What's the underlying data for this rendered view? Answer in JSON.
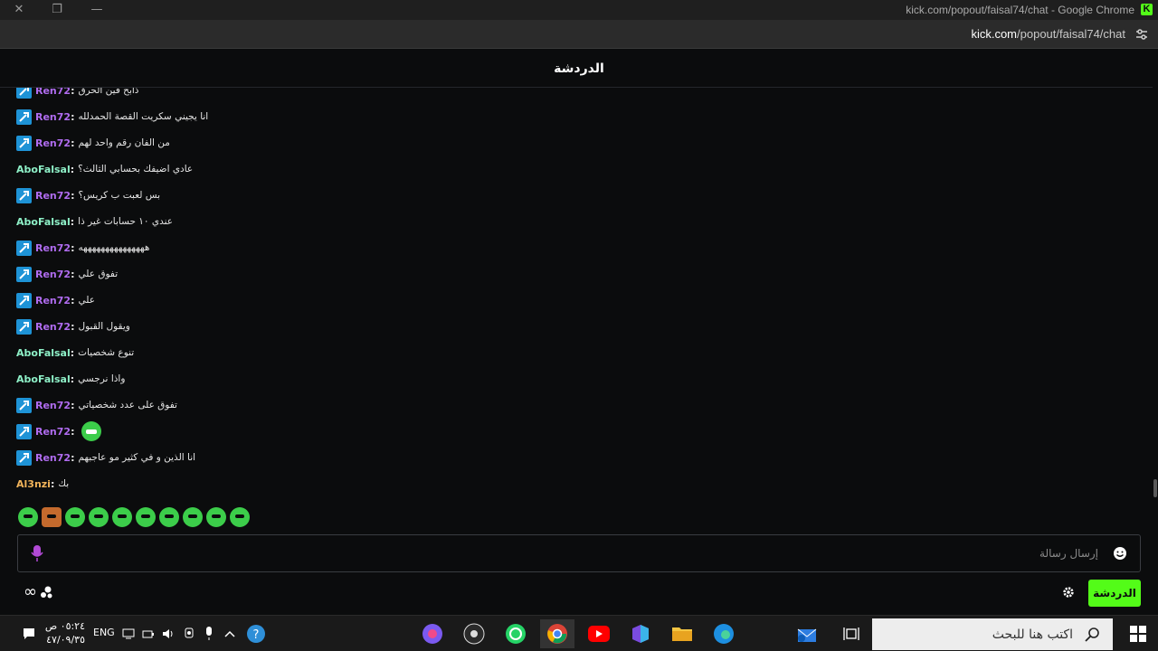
{
  "window": {
    "title": "kick.com/popout/faisal74/chat - Google Chrome",
    "app_badge": "K"
  },
  "address": {
    "host": "kick.com",
    "path": "/popout/faisal74/chat"
  },
  "chat": {
    "header_title": "الدردشة",
    "messages": [
      {
        "user": "Ren72",
        "badge": true,
        "color": "#b06cf0",
        "text": "ذابح فين الحرق"
      },
      {
        "user": "Ren72",
        "badge": true,
        "color": "#b06cf0",
        "text": "انا يجيني سكريت القصة الحمدلله"
      },
      {
        "user": "Ren72",
        "badge": true,
        "color": "#b06cf0",
        "text": "من الفان رقم واحد لهم"
      },
      {
        "user": "AboFalsal",
        "badge": false,
        "color": "#8ef0c7",
        "text": "عادي اضيفك بحسابي الثالث؟"
      },
      {
        "user": "Ren72",
        "badge": true,
        "color": "#b06cf0",
        "text": "بس لعبت ب كريس؟"
      },
      {
        "user": "AboFalsal",
        "badge": false,
        "color": "#8ef0c7",
        "text": "عندي ١٠ حسابات غير ذا"
      },
      {
        "user": "Ren72",
        "badge": true,
        "color": "#b06cf0",
        "text": "هههههههههههههههه"
      },
      {
        "user": "Ren72",
        "badge": true,
        "color": "#b06cf0",
        "text": "تفوق علي"
      },
      {
        "user": "Ren72",
        "badge": true,
        "color": "#b06cf0",
        "text": "علي"
      },
      {
        "user": "Ren72",
        "badge": true,
        "color": "#b06cf0",
        "text": "ويقول القبول"
      },
      {
        "user": "AboFalsal",
        "badge": false,
        "color": "#8ef0c7",
        "text": "تنوع شخصيات"
      },
      {
        "user": "AboFalsal",
        "badge": false,
        "color": "#8ef0c7",
        "text": "واذا نرجسي"
      },
      {
        "user": "Ren72",
        "badge": true,
        "color": "#b06cf0",
        "text": "تفوق على عدد شخصياتي"
      },
      {
        "user": "Ren72",
        "badge": true,
        "color": "#b06cf0",
        "text": "",
        "emote": "green-smile-emote"
      },
      {
        "user": "Ren72",
        "badge": true,
        "color": "#b06cf0",
        "text": "انا الذين و في كثير مو عاجبهم"
      },
      {
        "user": "Al3nzi",
        "badge": false,
        "color": "#f0b35a",
        "text": "بك"
      }
    ],
    "input_placeholder": "إرسال رسالة",
    "send_button_label": "الدردشة",
    "emote_bar": [
      "emote-1",
      "emote-2",
      "emote-3",
      "emote-4",
      "emote-5",
      "emote-6",
      "emote-7",
      "emote-8",
      "emote-9",
      "emote-10"
    ]
  },
  "taskbar": {
    "search_placeholder": "اكتب هنا للبحث",
    "clock_time": "٠٥:٢٤ ص",
    "clock_date": "٤٧/٠٩/٣٥",
    "language": "ENG"
  },
  "colors": {
    "kick_green": "#53fc18",
    "badge_blue": "#1e93d6",
    "bg": "#0b0c0d"
  }
}
